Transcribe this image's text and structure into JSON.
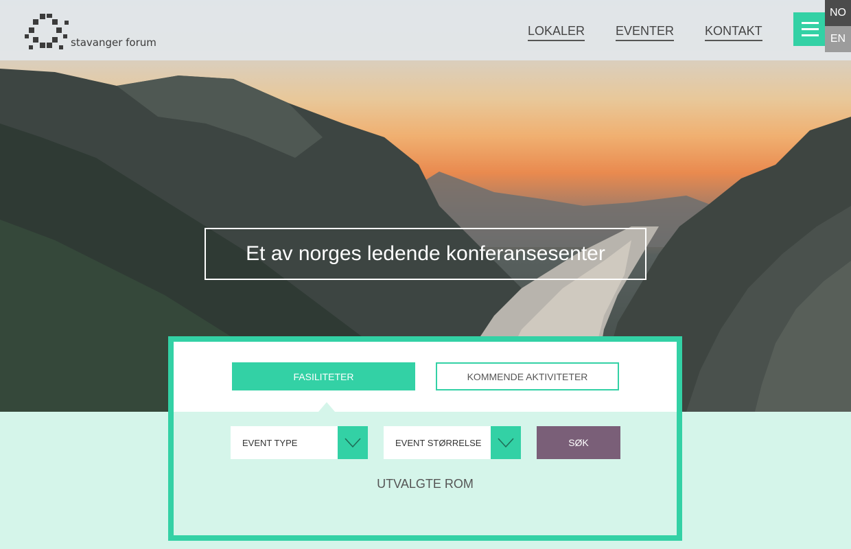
{
  "header": {
    "logo_text": "stavanger forum",
    "nav": [
      "LOKALER",
      "EVENTER",
      "KONTAKT"
    ],
    "languages": [
      "NO",
      "EN"
    ],
    "menu_icon": "hamburger-icon"
  },
  "hero": {
    "tagline": "Et av norges ledende konferansesenter"
  },
  "search": {
    "tabs": [
      {
        "label": "FASILITETER",
        "active": true
      },
      {
        "label": "KOMMENDE AKTIVITETER",
        "active": false
      }
    ],
    "event_type": "EVENT TYPE",
    "event_size": "EVENT STØRRELSE",
    "search_button": "SØK",
    "selected_rooms": "UTVALGTE ROM"
  },
  "colors": {
    "accent": "#33d1a5",
    "panel_background": "#d5f5ea",
    "search_button": "#7a5f78",
    "lang_active": "#4b4b4b",
    "lang_inactive": "#9c9c9c"
  }
}
